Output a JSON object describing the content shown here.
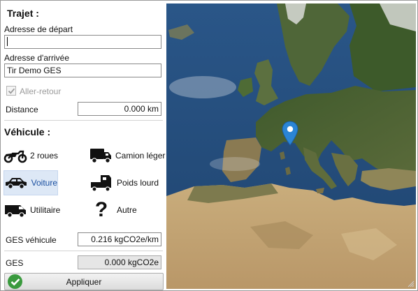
{
  "trajet": {
    "title": "Trajet :",
    "departure_label": "Adresse de départ",
    "departure_value": "",
    "arrival_label": "Adresse d'arrivée",
    "arrival_value": "Tir Demo GES",
    "round_trip_label": "Aller-retour",
    "round_trip_checked": true,
    "distance_label": "Distance",
    "distance_value": "0.000 km"
  },
  "vehicule": {
    "title": "Véhicule :",
    "options": [
      {
        "label": "2 roues",
        "icon": "motorcycle-icon",
        "selected": false
      },
      {
        "label": "Camion léger",
        "icon": "light-truck-icon",
        "selected": false
      },
      {
        "label": "Voiture",
        "icon": "car-icon",
        "selected": true
      },
      {
        "label": "Poids lourd",
        "icon": "heavy-truck-icon",
        "selected": false
      },
      {
        "label": "Utilitaire",
        "icon": "van-icon",
        "selected": false
      },
      {
        "label": "Autre",
        "icon": "question-mark-icon",
        "selected": false
      }
    ],
    "ges_vehicle_label": "GES véhicule",
    "ges_vehicle_value": "0.216 kgCO2e/km"
  },
  "ges": {
    "label": "GES",
    "value": "0.000 kgCO2e"
  },
  "apply_button": {
    "label": "Appliquer",
    "icon": "checkmark-icon"
  },
  "map": {
    "marker_icon": "map-pin-icon",
    "marker_color": "#2b85d6"
  },
  "colors": {
    "selection_bg": "#dde8f6",
    "selection_text": "#1a4fa0",
    "ok_green": "#3a9a3e"
  }
}
